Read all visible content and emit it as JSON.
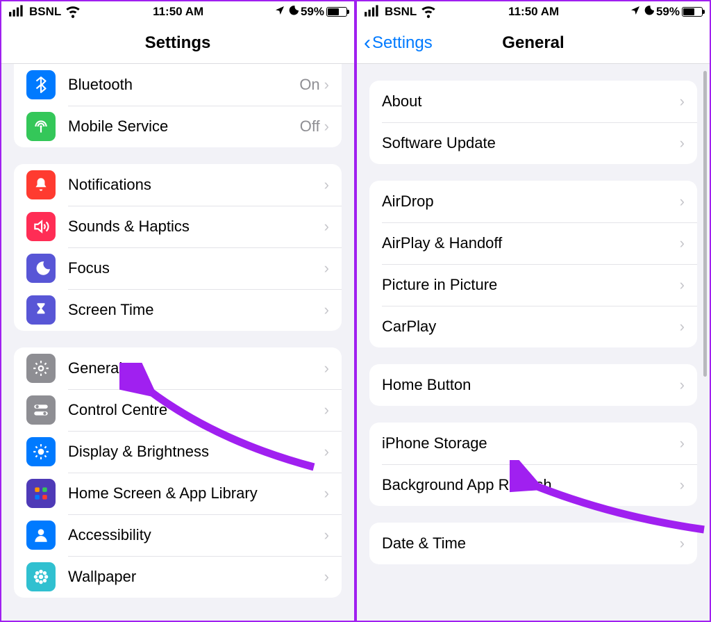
{
  "status": {
    "carrier": "BSNL",
    "time": "11:50 AM",
    "battery_pct": "59%"
  },
  "left": {
    "nav_title": "Settings",
    "group1": [
      {
        "label": "Bluetooth",
        "value": "On",
        "color": "#007aff",
        "icon": "bluetooth"
      },
      {
        "label": "Mobile Service",
        "value": "Off",
        "color": "#34c759",
        "icon": "antenna"
      }
    ],
    "group2": [
      {
        "label": "Notifications",
        "color": "#ff3b30",
        "icon": "bell"
      },
      {
        "label": "Sounds & Haptics",
        "color": "#ff2d55",
        "icon": "speaker"
      },
      {
        "label": "Focus",
        "color": "#5856d6",
        "icon": "moon"
      },
      {
        "label": "Screen Time",
        "color": "#5856d6",
        "icon": "hourglass"
      }
    ],
    "group3": [
      {
        "label": "General",
        "color": "#8e8e93",
        "icon": "gear"
      },
      {
        "label": "Control Centre",
        "color": "#8e8e93",
        "icon": "switches"
      },
      {
        "label": "Display & Brightness",
        "color": "#007aff",
        "icon": "sun"
      },
      {
        "label": "Home Screen & App Library",
        "color": "#4e3ab7",
        "icon": "grid"
      },
      {
        "label": "Accessibility",
        "color": "#007aff",
        "icon": "person"
      },
      {
        "label": "Wallpaper",
        "color": "#30c0d0",
        "icon": "flower"
      }
    ]
  },
  "right": {
    "back_label": "Settings",
    "nav_title": "General",
    "group1": [
      {
        "label": "About"
      },
      {
        "label": "Software Update"
      }
    ],
    "group2": [
      {
        "label": "AirDrop"
      },
      {
        "label": "AirPlay & Handoff"
      },
      {
        "label": "Picture in Picture"
      },
      {
        "label": "CarPlay"
      }
    ],
    "group3": [
      {
        "label": "Home Button"
      }
    ],
    "group4": [
      {
        "label": "iPhone Storage"
      },
      {
        "label": "Background App Refresh"
      }
    ],
    "group5": [
      {
        "label": "Date & Time"
      }
    ]
  }
}
